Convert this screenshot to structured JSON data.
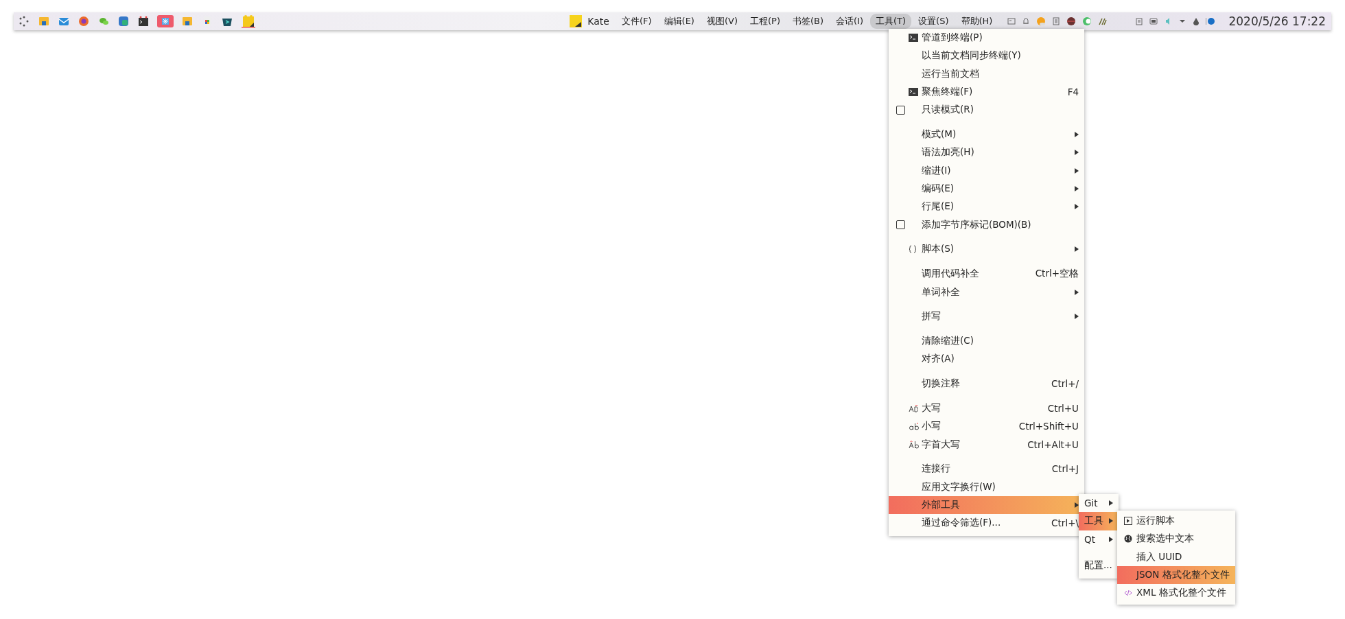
{
  "taskbar": {
    "app_name": "Kate",
    "menus": [
      {
        "label": "文件(F)",
        "selected": false
      },
      {
        "label": "编辑(E)",
        "selected": false
      },
      {
        "label": "视图(V)",
        "selected": false
      },
      {
        "label": "工程(P)",
        "selected": false
      },
      {
        "label": "书签(B)",
        "selected": false
      },
      {
        "label": "会话(I)",
        "selected": false
      },
      {
        "label": "工具(T)",
        "selected": true
      },
      {
        "label": "设置(S)",
        "selected": false
      },
      {
        "label": "帮助(H)",
        "selected": false
      }
    ],
    "clock": "2020/5/26 17:22"
  },
  "tools_menu": {
    "sections": [
      [
        {
          "kind": "terminal",
          "label": "管道到终端(P)",
          "submenu": false,
          "selected": false
        },
        {
          "kind": "plain",
          "label": "以当前文档同步终端(Y)",
          "submenu": false,
          "selected": false
        },
        {
          "kind": "plain",
          "label": "运行当前文档",
          "submenu": false,
          "selected": false
        },
        {
          "kind": "terminal",
          "label": "聚焦终端(F)",
          "shortcut": "F4",
          "submenu": false,
          "selected": false
        },
        {
          "kind": "check",
          "checked": false,
          "label": "只读模式(R)",
          "submenu": false,
          "selected": false
        }
      ],
      [
        {
          "kind": "plain",
          "label": "模式(M)",
          "submenu": true,
          "selected": false
        },
        {
          "kind": "plain",
          "label": "语法加亮(H)",
          "submenu": true,
          "selected": false
        },
        {
          "kind": "plain",
          "label": "缩进(I)",
          "submenu": true,
          "selected": false
        },
        {
          "kind": "plain",
          "label": "编码(E)",
          "submenu": true,
          "selected": false
        },
        {
          "kind": "plain",
          "label": "行尾(E)",
          "submenu": true,
          "selected": false
        },
        {
          "kind": "check",
          "checked": false,
          "label": "添加字节序标记(BOM)(B)",
          "submenu": false,
          "selected": false
        }
      ],
      [
        {
          "kind": "braces",
          "label": "脚本(S)",
          "submenu": true,
          "selected": false
        }
      ],
      [
        {
          "kind": "plain",
          "label": "调用代码补全",
          "shortcut": "Ctrl+空格",
          "submenu": false,
          "selected": false
        },
        {
          "kind": "plain",
          "label": "单词补全",
          "submenu": true,
          "selected": false
        }
      ],
      [
        {
          "kind": "plain",
          "label": "拼写",
          "submenu": true,
          "selected": false
        }
      ],
      [
        {
          "kind": "plain",
          "label": "清除缩进(C)",
          "submenu": false,
          "selected": false
        },
        {
          "kind": "plain",
          "label": "对齐(A)",
          "submenu": false,
          "selected": false
        }
      ],
      [
        {
          "kind": "plain",
          "label": "切换注释",
          "shortcut": "Ctrl+/",
          "submenu": false,
          "selected": false
        }
      ],
      [
        {
          "kind": "uppercase",
          "label": "大写",
          "shortcut": "Ctrl+U",
          "submenu": false,
          "selected": false
        },
        {
          "kind": "lowercase",
          "label": "小写",
          "shortcut": "Ctrl+Shift+U",
          "submenu": false,
          "selected": false
        },
        {
          "kind": "capitalize",
          "label": "字首大写",
          "shortcut": "Ctrl+Alt+U",
          "submenu": false,
          "selected": false
        }
      ],
      [
        {
          "kind": "plain",
          "label": "连接行",
          "shortcut": "Ctrl+J",
          "submenu": false,
          "selected": false
        },
        {
          "kind": "plain",
          "label": "应用文字换行(W)",
          "submenu": false,
          "selected": false
        },
        {
          "kind": "plain",
          "label": "外部工具",
          "submenu": true,
          "selected": true
        },
        {
          "kind": "plain",
          "label": "通过命令筛选(F)...",
          "shortcut": "Ctrl+\\",
          "submenu": false,
          "selected": false
        }
      ]
    ]
  },
  "external_tools_submenu": {
    "items": [
      {
        "label": "Git",
        "submenu": true,
        "selected": false,
        "gap_before": false
      },
      {
        "label": "工具",
        "submenu": true,
        "selected": true,
        "gap_before": false
      },
      {
        "label": "Qt",
        "submenu": true,
        "selected": false,
        "gap_before": false
      },
      {
        "label": "配置...",
        "submenu": false,
        "selected": false,
        "gap_before": true
      }
    ]
  },
  "tools_submenu": {
    "items": [
      {
        "kind": "run",
        "label": "运行脚本",
        "selected": false
      },
      {
        "kind": "globe",
        "label": "搜索选中文本",
        "selected": false
      },
      {
        "kind": "plain",
        "label": "插入 UUID",
        "selected": false
      },
      {
        "kind": "plain",
        "label": "JSON 格式化整个文件",
        "selected": true
      },
      {
        "kind": "xml",
        "label": "XML 格式化整个文件",
        "selected": false
      }
    ]
  }
}
